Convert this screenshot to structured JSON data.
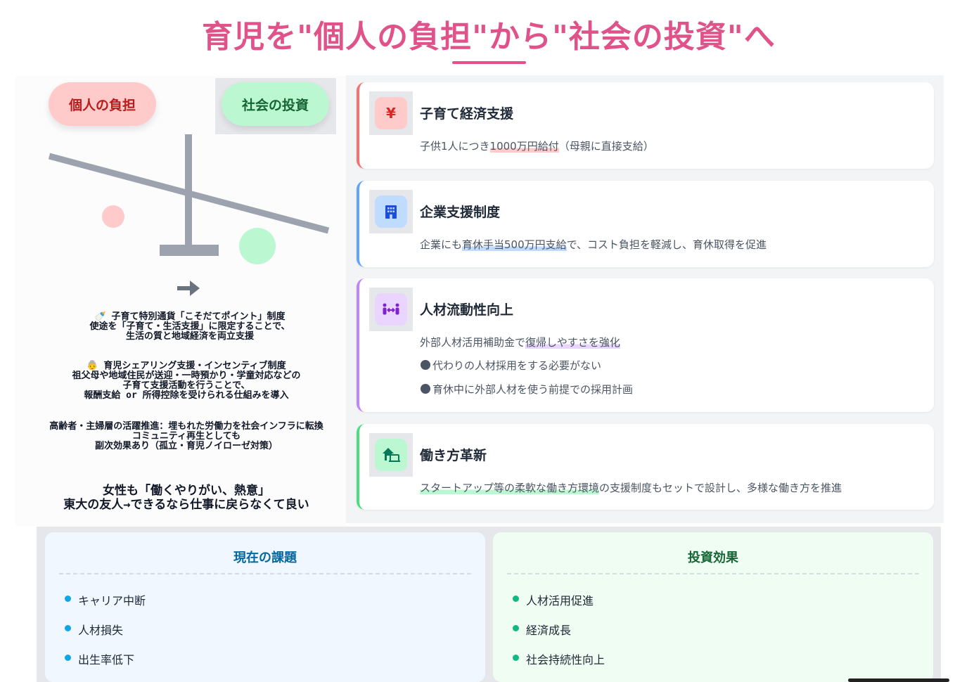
{
  "header": {
    "title": "育児を\"個人の負担\"から\"社会の投資\"へ"
  },
  "balance": {
    "left_label": "個人の負担",
    "right_label": "社会の投資"
  },
  "notes": {
    "note1": [
      "🍼 子育て特別通貨「こそだてポイント」制度",
      "使途を「子育て・生活支援」に限定することで、",
      "生活の質と地域経済を両立支援"
    ],
    "note2": [
      "👵 育児シェアリング支援・インセンティブ制度",
      "祖父母や地域住民が送迎・一時預かり・学童対応などの",
      "子育て支援活動を行うことで、",
      "報酬支給 or 所得控除を受けられる仕組みを導入"
    ],
    "note3": [
      "高齢者・主婦層の活躍推進：埋もれた労働力を社会インフラに転換",
      "コミュニティ再生としても",
      "副次効果あり（孤立・育児ノイローゼ対策）"
    ],
    "note4": [
      "女性も「働くやりがい、熱意」",
      "東大の友人→できるなら仕事に戻らなくて良い"
    ]
  },
  "cards": [
    {
      "icon": "yen-icon",
      "icon_glyph": "¥",
      "title": "子育て経済支援",
      "desc_pre": "子供1人につき",
      "desc_hl": "1000万円給付",
      "desc_post": "（母親に直接支給）"
    },
    {
      "icon": "building-icon",
      "title": "企業支援制度",
      "desc_pre": "企業にも",
      "desc_hl": "育休手当500万円支給",
      "desc_post": "で、コスト負担を軽減し、育休取得を促進"
    },
    {
      "icon": "people-arrows-icon",
      "title": "人材流動性向上",
      "desc_pre": "外部人材活用補助金で",
      "desc_hl": "復帰しやすさを強化",
      "desc_post": "",
      "bullets": [
        "代わりの人材採用をする必要がない",
        "育休中に外部人材を使う前提での採用計画"
      ]
    },
    {
      "icon": "home-work-icon",
      "title": "働き方革新",
      "desc_pre": "",
      "desc_hl": "スタートアップ等の柔軟な働き方環境",
      "desc_post": "の支援制度もセットで設計し、多様な働き方を推進"
    }
  ],
  "issues": {
    "title": "現在の課題",
    "items": [
      "キャリア中断",
      "人材損失",
      "出生率低下"
    ]
  },
  "effects": {
    "title": "投資効果",
    "items": [
      "人材活用促進",
      "経済成長",
      "社会持続性向上"
    ]
  }
}
